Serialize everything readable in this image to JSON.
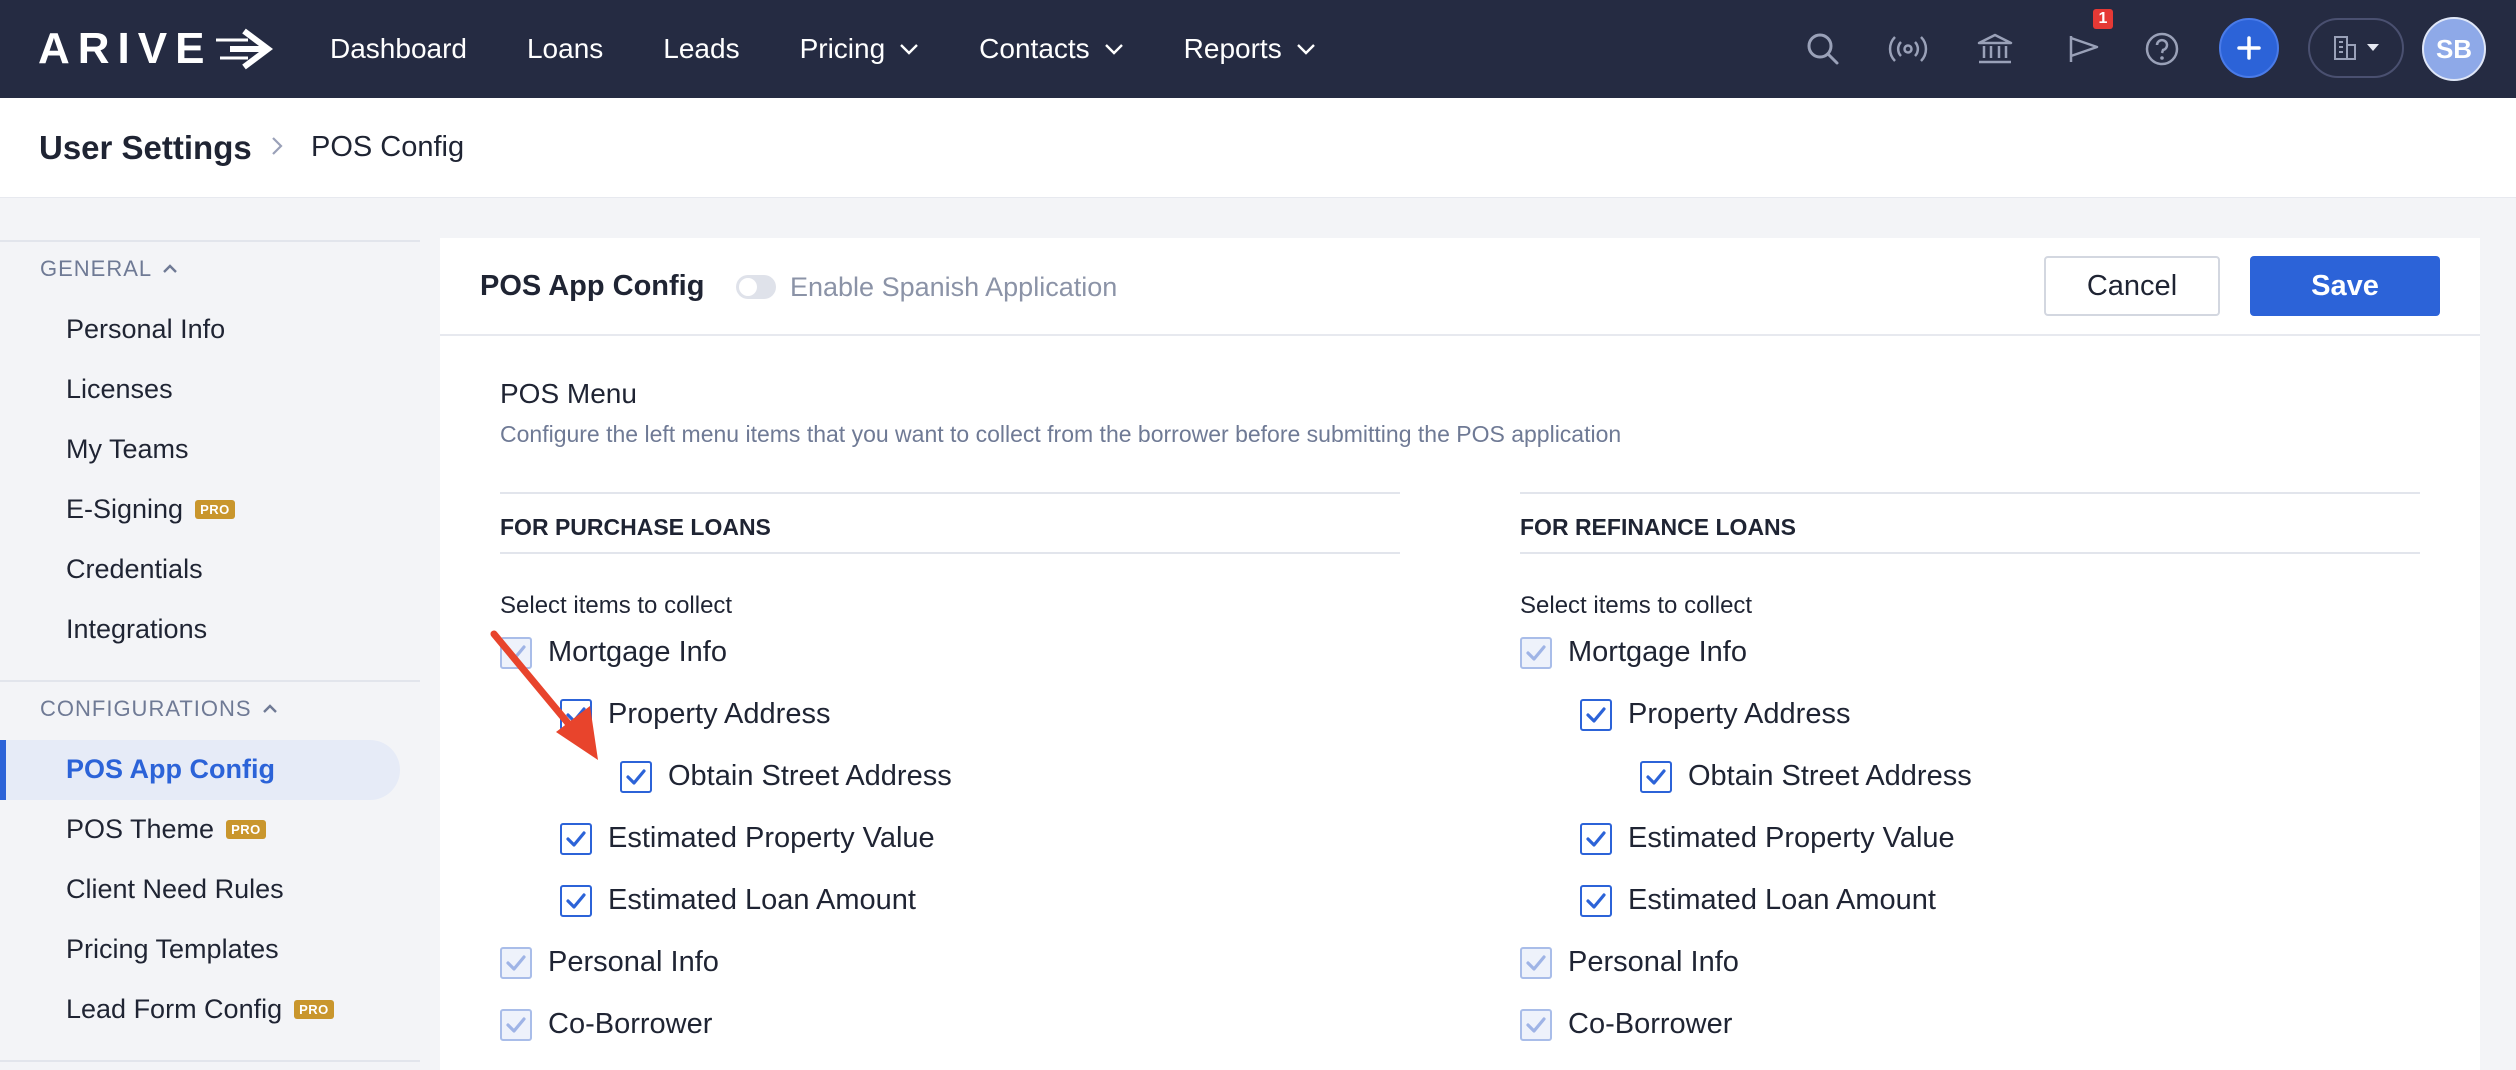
{
  "nav": {
    "logo": "ARIVE",
    "items": [
      {
        "label": "Dashboard",
        "dropdown": false
      },
      {
        "label": "Loans",
        "dropdown": false
      },
      {
        "label": "Leads",
        "dropdown": false
      },
      {
        "label": "Pricing",
        "dropdown": true
      },
      {
        "label": "Contacts",
        "dropdown": true
      },
      {
        "label": "Reports",
        "dropdown": true
      }
    ],
    "notification_count": "1",
    "avatar_initials": "SB"
  },
  "breadcrumb": {
    "root": "User Settings",
    "current": "POS Config"
  },
  "sidebar": {
    "general_label": "GENERAL",
    "general_items": [
      {
        "label": "Personal Info",
        "pro": false
      },
      {
        "label": "Licenses",
        "pro": false
      },
      {
        "label": "My Teams",
        "pro": false
      },
      {
        "label": "E-Signing",
        "pro": true
      },
      {
        "label": "Credentials",
        "pro": false
      },
      {
        "label": "Integrations",
        "pro": false
      }
    ],
    "config_label": "CONFIGURATIONS",
    "config_items": [
      {
        "label": "POS App Config",
        "pro": false,
        "active": true
      },
      {
        "label": "POS Theme",
        "pro": true
      },
      {
        "label": "Client Need Rules",
        "pro": false
      },
      {
        "label": "Pricing Templates",
        "pro": false
      },
      {
        "label": "Lead Form Config",
        "pro": true
      }
    ],
    "pro_label": "PRO"
  },
  "card": {
    "title": "POS App Config",
    "toggle_label": "Enable Spanish Application",
    "toggle_on": false,
    "cancel_label": "Cancel",
    "save_label": "Save",
    "section_title": "POS Menu",
    "section_desc": "Configure the left menu items that you want to collect from the borrower before submitting the POS application"
  },
  "purchase": {
    "heading": "FOR PURCHASE LOANS",
    "sub": "Select items to collect",
    "items": [
      {
        "label": "Mortgage Info",
        "level": 0,
        "state": "disabled-checked"
      },
      {
        "label": "Property Address",
        "level": 1,
        "state": "checked"
      },
      {
        "label": "Obtain Street Address",
        "level": 2,
        "state": "checked"
      },
      {
        "label": "Estimated Property Value",
        "level": 1,
        "state": "checked"
      },
      {
        "label": "Estimated Loan Amount",
        "level": 1,
        "state": "checked"
      },
      {
        "label": "Personal Info",
        "level": 0,
        "state": "disabled-checked"
      },
      {
        "label": "Co-Borrower",
        "level": 0,
        "state": "disabled-checked"
      }
    ]
  },
  "refinance": {
    "heading": "FOR REFINANCE LOANS",
    "sub": "Select items to collect",
    "items": [
      {
        "label": "Mortgage Info",
        "level": 0,
        "state": "disabled-checked"
      },
      {
        "label": "Property Address",
        "level": 1,
        "state": "checked"
      },
      {
        "label": "Obtain Street Address",
        "level": 2,
        "state": "checked"
      },
      {
        "label": "Estimated Property Value",
        "level": 1,
        "state": "checked"
      },
      {
        "label": "Estimated Loan Amount",
        "level": 1,
        "state": "checked"
      },
      {
        "label": "Personal Info",
        "level": 0,
        "state": "disabled-checked"
      },
      {
        "label": "Co-Borrower",
        "level": 0,
        "state": "disabled-checked"
      }
    ]
  },
  "colors": {
    "nav_bg": "#252b42",
    "accent": "#2c63d8",
    "pro_badge": "#c9962d",
    "annotation_arrow": "#e8442c"
  }
}
